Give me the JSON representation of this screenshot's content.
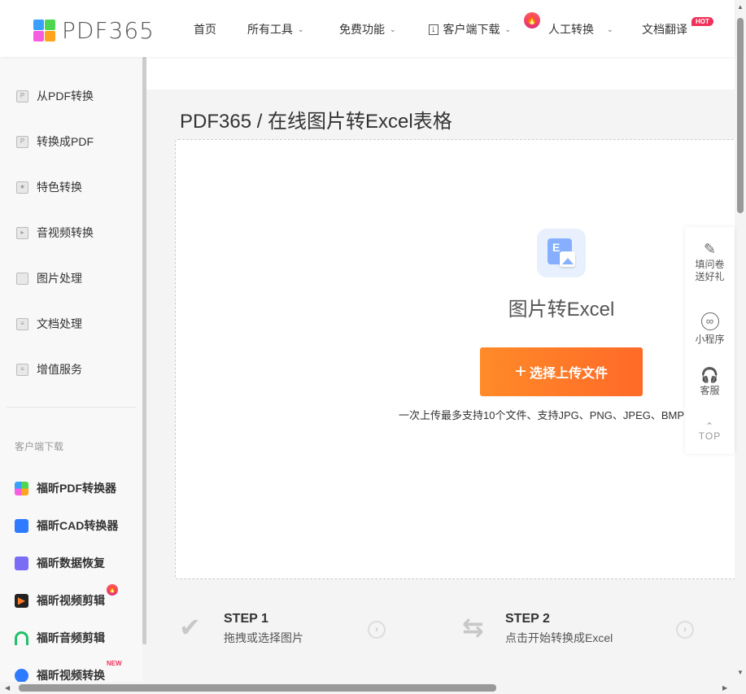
{
  "header": {
    "logo_text": "PDF365",
    "nav": [
      {
        "label": "首页"
      },
      {
        "label": "所有工具",
        "dropdown": true
      },
      {
        "label": "免费功能",
        "dropdown": true
      },
      {
        "label": "客户端下载",
        "dropdown": true,
        "icon": "download-icon"
      },
      {
        "label": "人工转换",
        "dropdown": true,
        "badge": "fire-icon"
      },
      {
        "label": "文档翻译",
        "badge": "HOT"
      }
    ]
  },
  "sidebar": {
    "items": [
      {
        "label": "从PDF转换",
        "icon": "from-pdf-icon"
      },
      {
        "label": "转换成PDF",
        "icon": "to-pdf-icon"
      },
      {
        "label": "特色转换",
        "icon": "star-shield-icon"
      },
      {
        "label": "音视频转换",
        "icon": "video-icon"
      },
      {
        "label": "图片处理",
        "icon": "image-icon"
      },
      {
        "label": "文档处理",
        "icon": "document-icon"
      },
      {
        "label": "增值服务",
        "icon": "list-icon"
      }
    ],
    "download_label": "客户端下载",
    "apps": [
      {
        "label": "福昕PDF转换器",
        "color": "#4aa3ff"
      },
      {
        "label": "福昕CAD转换器",
        "color": "#2f7bff"
      },
      {
        "label": "福昕数据恢复",
        "color": "#7a6cf5"
      },
      {
        "label": "福昕视频剪辑",
        "color": "#222222",
        "badge": "fire-icon"
      },
      {
        "label": "福昕音频剪辑",
        "color": "#22c06a"
      },
      {
        "label": "福昕视频转换",
        "color": "#2f7bff",
        "badge": "NEW"
      }
    ]
  },
  "main": {
    "breadcrumb": "PDF365 / 在线图片转Excel表格",
    "tool_title": "图片转Excel",
    "file_icon_letter": "E",
    "upload_label": "选择上传文件",
    "hint": "一次上传最多支持10个文件、支持JPG、PNG、JPEG、BMP",
    "steps": [
      {
        "title": "STEP 1",
        "desc": "拖拽或选择图片"
      },
      {
        "title": "STEP 2",
        "desc": "点击开始转换成Excel"
      }
    ]
  },
  "float_panel": {
    "survey": "填问卷送好礼",
    "mini_program": "小程序",
    "service": "客服",
    "top": "TOP"
  },
  "colors": {
    "accent": "#ff7a28",
    "hot": "#f0325a"
  }
}
